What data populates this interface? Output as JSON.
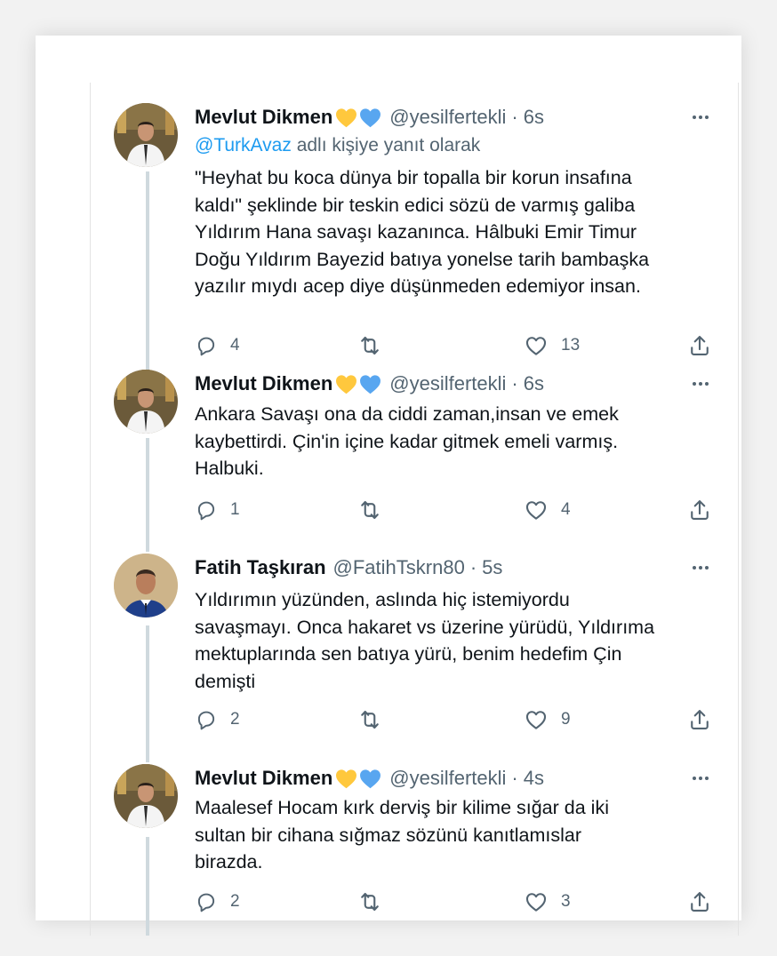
{
  "tweets": [
    {
      "name": "Mevlut Dikmen",
      "handle": "@yesilfertekli",
      "time": "6s",
      "reply_mention": "@TurkAvaz",
      "reply_suffix": "adlı kişiye yanıt olarak",
      "lines": [
        "\"Heyhat bu koca dünya bir topalla bir korun insafına",
        "kaldı\" şeklinde bir teskin edici sözü de varmış galiba",
        "Yıldırım Hana savaşı kazanınca. Hâlbuki Emir Timur",
        "Doğu Yıldırım Bayezid batıya yonelse tarih bambaşka",
        "yazılır mıydı acep diye düşünmeden edemiyor insan."
      ],
      "replies": "4",
      "retweets": "",
      "likes": "13"
    },
    {
      "name": "Mevlut Dikmen",
      "handle": "@yesilfertekli",
      "time": "6s",
      "lines": [
        "Ankara Savaşı ona da ciddi zaman,insan ve emek",
        "kaybettirdi. Çin'in içine kadar gitmek emeli varmış.",
        "Halbuki."
      ],
      "replies": "1",
      "retweets": "",
      "likes": "4"
    },
    {
      "name": "Fatih Taşkıran",
      "handle": "@FatihTskrn80",
      "time": "5s",
      "lines": [
        "Yıldırımın yüzünden, aslında hiç istemiyordu",
        "savaşmayı. Onca hakaret vs üzerine yürüdü, Yıldırıma",
        "mektuplarında sen batıya yürü, benim hedefim Çin",
        "demişti"
      ],
      "replies": "2",
      "retweets": "",
      "likes": "9"
    },
    {
      "name": "Mevlut Dikmen",
      "handle": "@yesilfertekli",
      "time": "4s",
      "lines": [
        "Maalesef Hocam kırk derviş bir kilime sığar da iki",
        "sultan bir cihana sığmaz sözünü kanıtlamıslar",
        "birazda."
      ],
      "replies": "2",
      "retweets": "",
      "likes": "3"
    }
  ],
  "separator": "·",
  "icons": {
    "reply": "reply-icon",
    "retweet": "retweet-icon",
    "like": "heart-icon",
    "share": "share-icon",
    "more": "more-icon",
    "badges": [
      "yellow-heart-icon",
      "blue-heart-icon"
    ]
  },
  "colors": {
    "text": "#0f1419",
    "secondary": "#536471",
    "link": "#1d9bf0",
    "thread_line": "#cfd9de",
    "yellow_heart": "#ffc83d",
    "blue_heart": "#58a6f0"
  }
}
